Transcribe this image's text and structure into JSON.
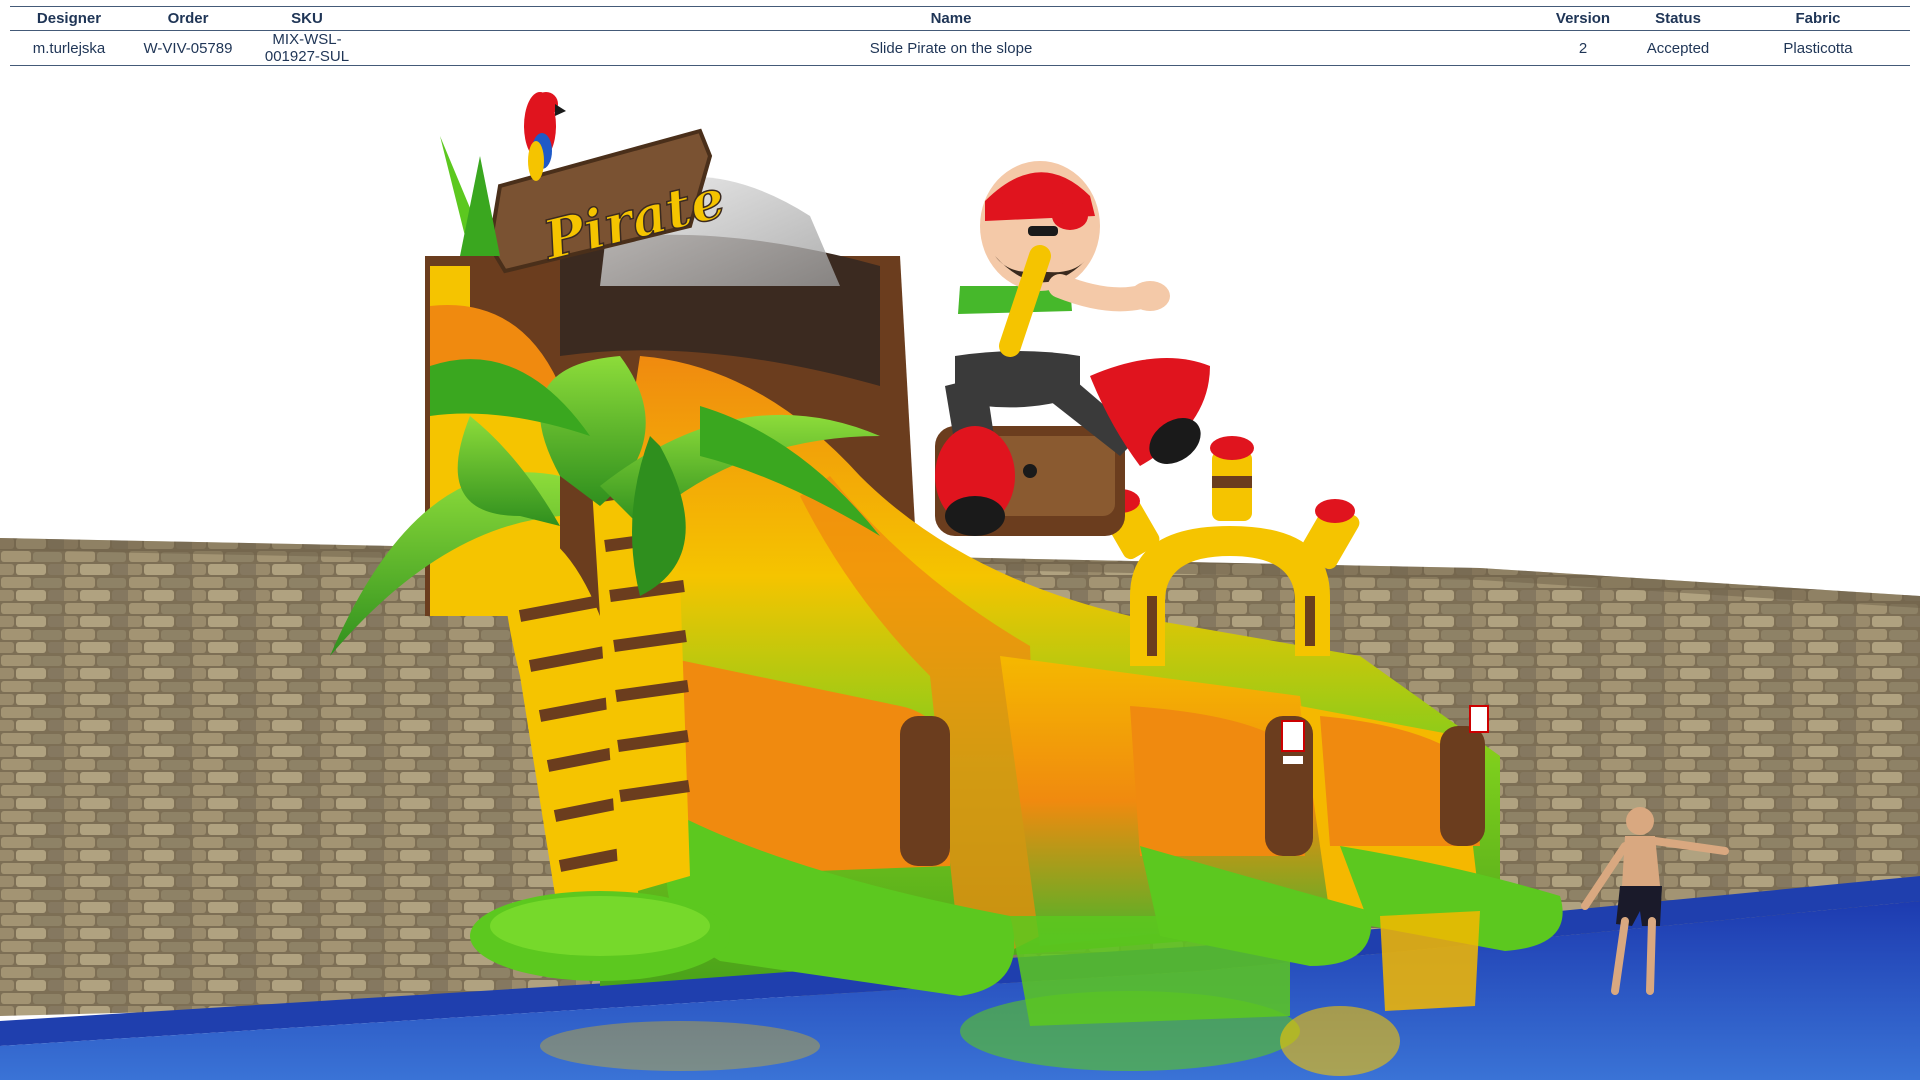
{
  "spec_table": {
    "headers": {
      "designer": "Designer",
      "order": "Order",
      "sku": "SKU",
      "name": "Name",
      "version": "Version",
      "status": "Status",
      "fabric": "Fabric"
    },
    "row": {
      "designer": "m.turlejska",
      "order": "W-VIV-05789",
      "sku": "MIX-WSL-001927-SUL",
      "name": "Slide Pirate on the slope",
      "version": "2",
      "status": "Accepted",
      "fabric": "Plasticotta"
    }
  },
  "render": {
    "sign_text": "Pirate",
    "colors": {
      "stone_wall": "#8a7a5c",
      "pool_blue": "#1f3fae",
      "slide_yellow": "#f5c400",
      "slide_orange": "#f08a0f",
      "slide_green": "#5cc81f",
      "slide_brown": "#6b3d1e",
      "pirate_red": "#e0141e",
      "sign_wood": "#7a5232"
    }
  }
}
